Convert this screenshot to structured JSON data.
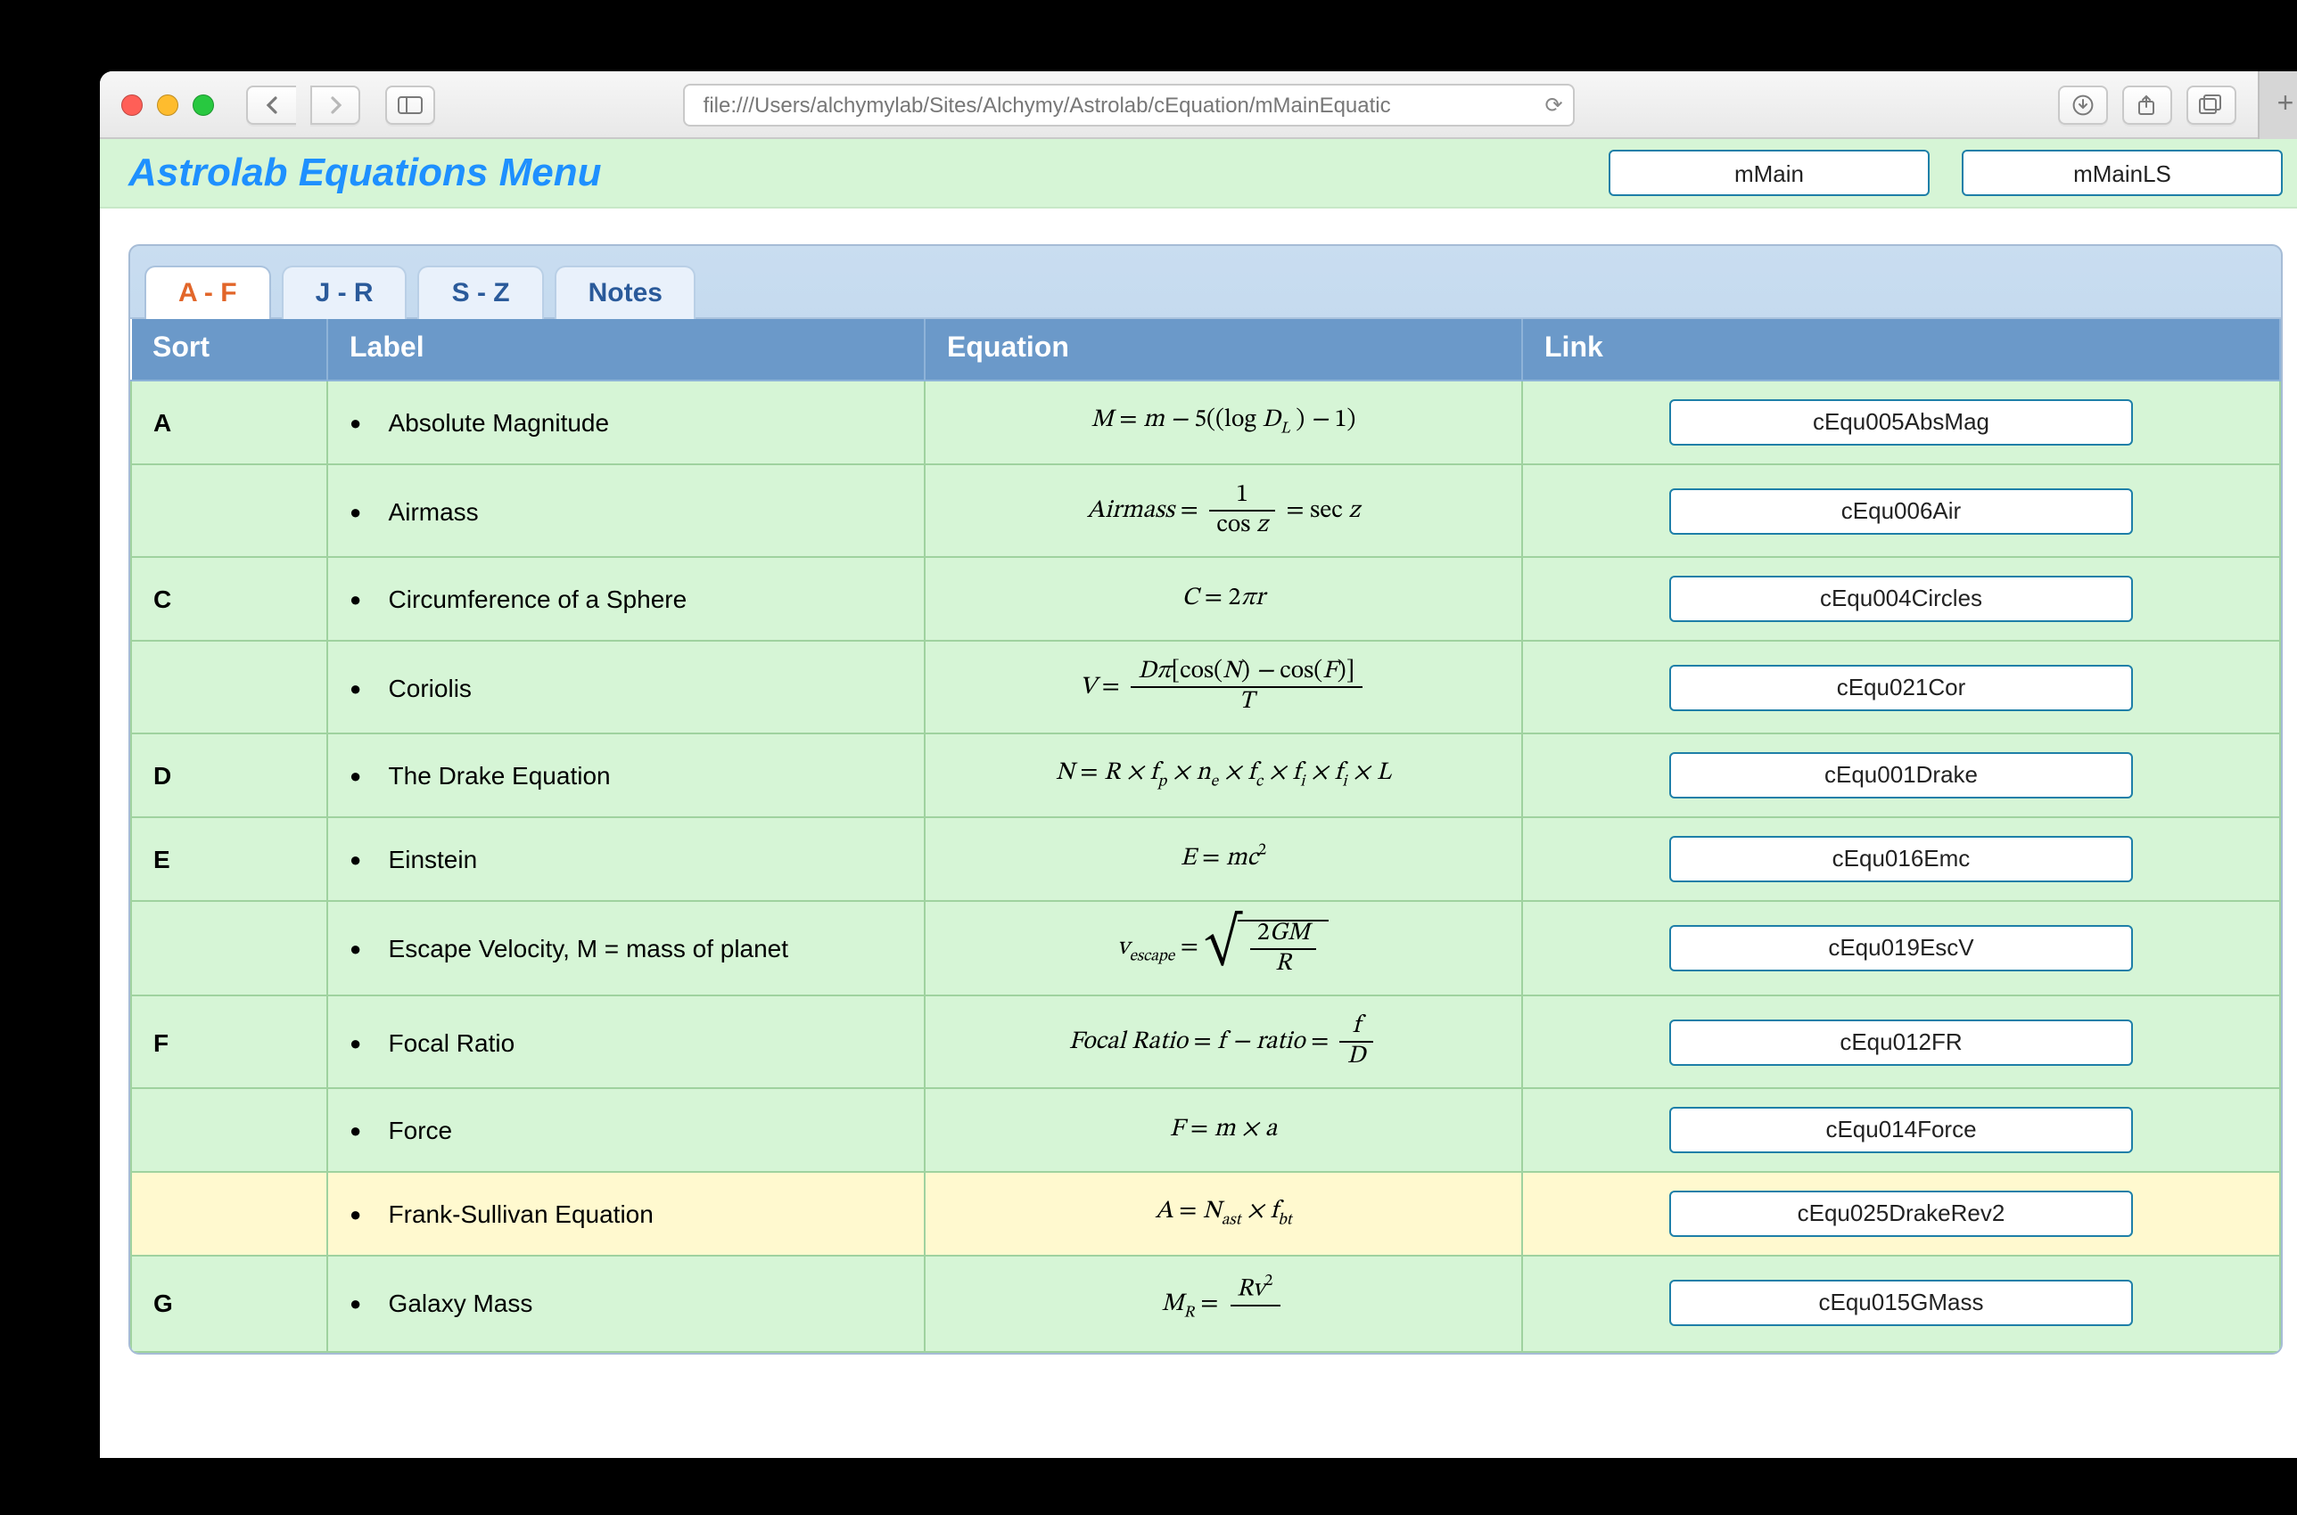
{
  "browser": {
    "address": "file:///Users/alchymylab/Sites/Alchymy/Astrolab/cEquation/mMainEquatic"
  },
  "header": {
    "title": "Astrolab Equations Menu",
    "buttons": [
      "mMain",
      "mMainLS"
    ]
  },
  "tabs": [
    "A - F",
    "J - R",
    "S - Z",
    "Notes"
  ],
  "active_tab": 0,
  "columns": [
    "Sort",
    "Label",
    "Equation",
    "Link"
  ],
  "rows": [
    {
      "sort": "A",
      "label": "Absolute Magnitude",
      "eq_key": "absmag",
      "link": "cEqu005AbsMag"
    },
    {
      "sort": "",
      "label": "Airmass",
      "eq_key": "airmass",
      "link": "cEqu006Air"
    },
    {
      "sort": "C",
      "label": "Circumference of a Sphere",
      "eq_key": "circ",
      "link": "cEqu004Circles"
    },
    {
      "sort": "",
      "label": "Coriolis",
      "eq_key": "coriolis",
      "link": "cEqu021Cor"
    },
    {
      "sort": "D",
      "label": "The Drake Equation",
      "eq_key": "drake",
      "link": "cEqu001Drake"
    },
    {
      "sort": "E",
      "label": "Einstein",
      "eq_key": "emc",
      "link": "cEqu016Emc"
    },
    {
      "sort": "",
      "label": "Escape Velocity, M = mass of planet",
      "eq_key": "escv",
      "link": "cEqu019EscV"
    },
    {
      "sort": "F",
      "label": "Focal Ratio",
      "eq_key": "focal",
      "link": "cEqu012FR"
    },
    {
      "sort": "",
      "label": "Force",
      "eq_key": "force",
      "link": "cEqu014Force"
    },
    {
      "sort": "",
      "label": "Frank-Sullivan Equation",
      "eq_key": "frank",
      "link": "cEqu025DrakeRev2",
      "hl": true
    },
    {
      "sort": "G",
      "label": "Galaxy Mass",
      "eq_key": "gmass",
      "link": "cEqu015GMass"
    }
  ],
  "equations_text": {
    "absmag": "M = m − 5((log D_L) − 1)",
    "airmass": "Airmass = 1 / cos z = sec z",
    "circ": "C = 2πr",
    "coriolis": "V = Dπ[cos(N) − cos(F)] / T",
    "drake": "N = R × f_p × n_e × f_c × f_i × f_i × L",
    "emc": "E = mc²",
    "escv": "v_escape = √(2GM / R)",
    "focal": "Focal Ratio = f − ratio = f / D",
    "force": "F = m × a",
    "frank": "A = N_ast × f_bt",
    "gmass": "M_R = Rv² / ..."
  }
}
